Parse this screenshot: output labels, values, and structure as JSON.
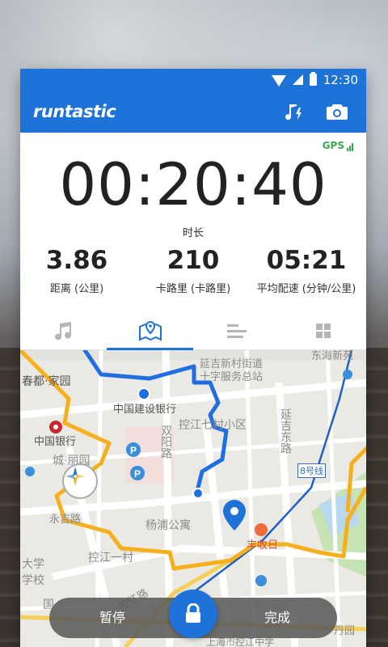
{
  "status_bar": {
    "time": "12:30"
  },
  "app_bar": {
    "brand": "runtastic"
  },
  "gps": {
    "label": "GPS"
  },
  "timer": {
    "value": "00:20:40",
    "label": "时长"
  },
  "metrics": [
    {
      "value": "3.86",
      "label": "距离 (公里)"
    },
    {
      "value": "210",
      "label": "卡路里 (卡路里)"
    },
    {
      "value": "05:21",
      "label": "平均配速 (分钟/公里)"
    }
  ],
  "tabs": [
    {
      "icon": "music-note-icon",
      "active": false
    },
    {
      "icon": "map-icon",
      "active": true
    },
    {
      "icon": "list-icon",
      "active": false
    },
    {
      "icon": "grid-icon",
      "active": false
    }
  ],
  "map": {
    "labels": {
      "chunduyijiayuan": "春都·家园",
      "yanji_jiedao": "延吉新村街道",
      "shizi_center": "十字服务总站",
      "ccb": "中国建设银行",
      "boc": "中国银行",
      "kongjiang_qicun": "控江七村小区",
      "shuangyang_road": "双阳路",
      "yanji_east": "延吉东路",
      "chengli_garden": "城·丽园",
      "yongji_road": "永吉路",
      "yangpu_gongyu": "杨浦公寓",
      "kongjiang_yicun": "控江一村",
      "fengshouri": "丰收日",
      "line8": "8号线",
      "daxue": "大学",
      "xuexiao": "学校",
      "guo": "国",
      "kongjiang_road": "控江路",
      "top_right": "东海新苑",
      "danyuan": "丹园",
      "bottom_right_text": "上海市控江中学"
    }
  },
  "controls": {
    "pause": "暂停",
    "finish": "完成"
  },
  "colors": {
    "primary": "#1f73d8",
    "gps_green": "#36a64f",
    "route_orange": "#f5b01e",
    "route_blue": "#1f6fe0"
  }
}
